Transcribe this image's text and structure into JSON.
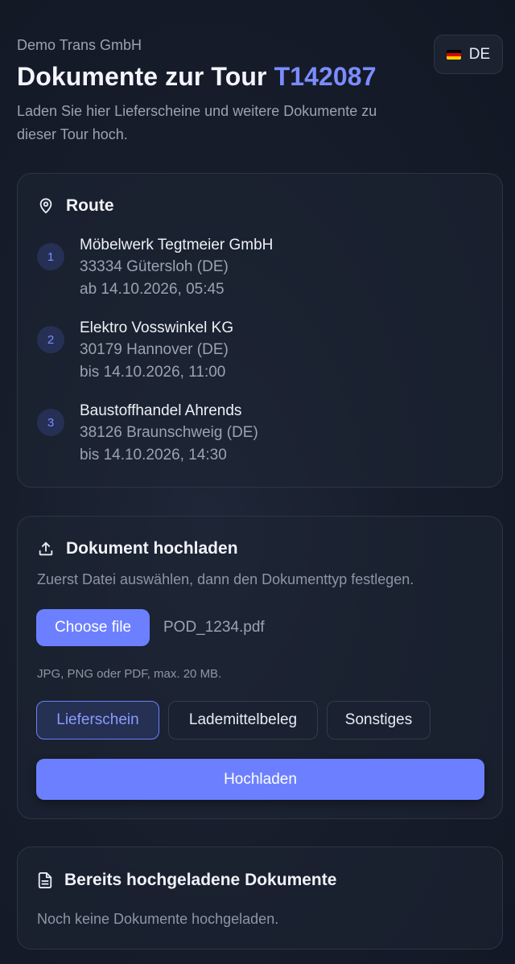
{
  "header": {
    "company": "Demo Trans GmbH",
    "title_prefix": "Dokumente zur Tour",
    "tour_id": "T142087",
    "subtitle": "Laden Sie hier Lieferscheine und weitere Dokumente zu dieser Tour hoch."
  },
  "language": {
    "label": "DE",
    "flag_colors": [
      "#000000",
      "#dd0000",
      "#ffce00"
    ]
  },
  "route": {
    "title": "Route",
    "stops": [
      {
        "num": "1",
        "name": "Möbelwerk Tegtmeier GmbH",
        "address": "33334 Gütersloh (DE)",
        "time": "ab 14.10.2026, 05:45"
      },
      {
        "num": "2",
        "name": "Elektro Vosswinkel KG",
        "address": "30179 Hannover (DE)",
        "time": "bis 14.10.2026, 11:00"
      },
      {
        "num": "3",
        "name": "Baustoffhandel Ahrends",
        "address": "38126 Braunschweig (DE)",
        "time": "bis 14.10.2026, 14:30"
      }
    ]
  },
  "upload": {
    "title": "Dokument hochladen",
    "hint": "Zuerst Datei auswählen, dann den Dokumenttyp festlegen.",
    "choose_label": "Choose file",
    "file_name": "POD_1234.pdf",
    "file_hint": "JPG, PNG oder PDF, max. 20 MB.",
    "types": [
      "Lieferschein",
      "Lademittelbeleg",
      "Sonstiges"
    ],
    "selected_type": "Lieferschein",
    "submit_label": "Hochladen"
  },
  "uploaded": {
    "title": "Bereits hochgeladene Dokumente",
    "empty": "Noch keine Dokumente hochgeladen."
  },
  "colors": {
    "accent": "#6c80ff",
    "background": "#171d2b"
  }
}
